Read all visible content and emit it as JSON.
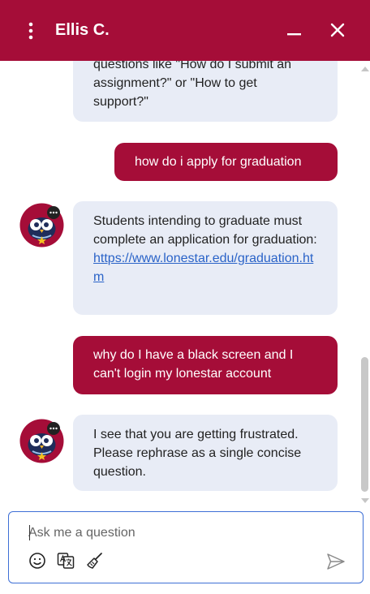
{
  "header": {
    "agent_name": "Ellis C.",
    "background_color": "#a50d38",
    "icons": [
      "more-vertical-icon",
      "minimize-icon",
      "close-icon"
    ]
  },
  "messages": [
    {
      "sender": "bot",
      "lines": [
        "questions like \"How do I submit an",
        "assignment?\" or \"How to get",
        "support?\""
      ]
    },
    {
      "sender": "user",
      "text": "how do i apply for graduation"
    },
    {
      "sender": "bot",
      "text": "Students intending to graduate must complete an application for graduation:",
      "link": "https://www.lonestar.edu/graduation.htm"
    },
    {
      "sender": "user",
      "text": "why do I have a black screen and I can't login my lonestar account"
    },
    {
      "sender": "bot",
      "text": "I see that you are getting frustrated. Please rephrase as a single concise question."
    }
  ],
  "composer": {
    "placeholder": "Ask me a question",
    "value": "",
    "tools": [
      "emoji-icon",
      "translate-icon",
      "clear-chat-broom-icon"
    ],
    "send_icon": "send-icon"
  },
  "colors": {
    "brand": "#a50d38",
    "bot_bubble": "#e8ecf6",
    "link": "#2a63c8",
    "input_border": "#3e6fd6"
  }
}
